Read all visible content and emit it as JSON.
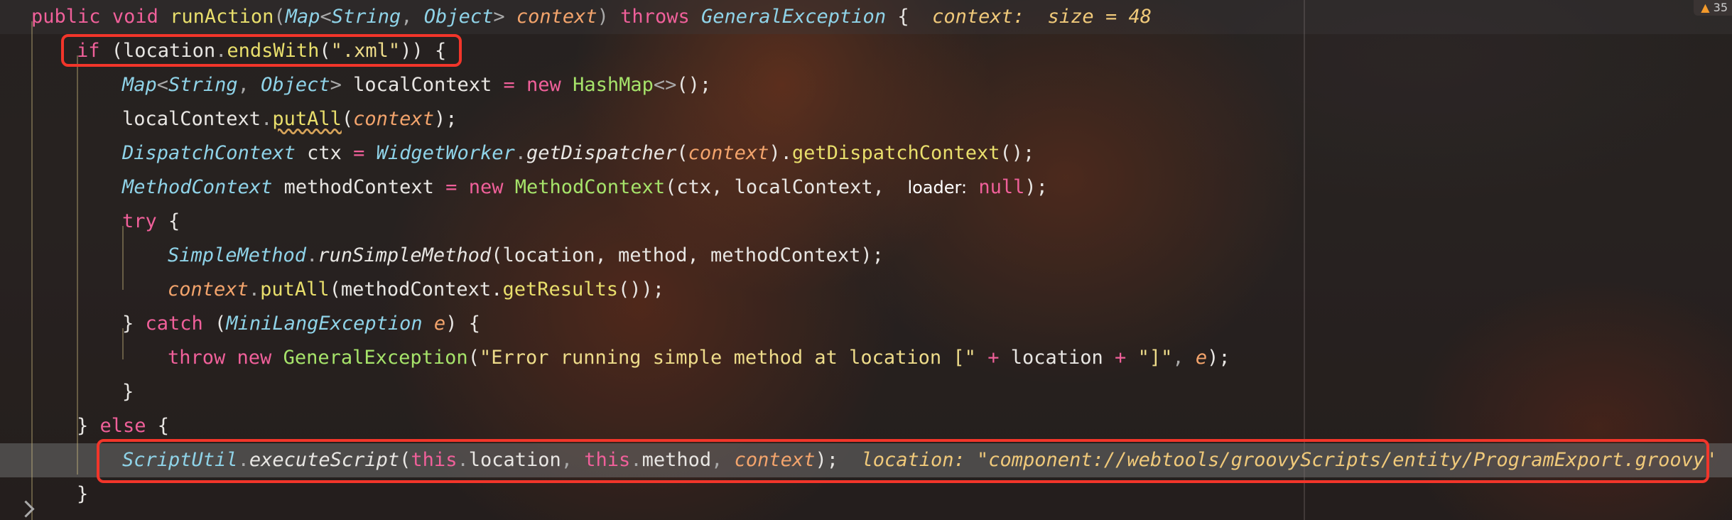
{
  "editor": {
    "warning_count": "35",
    "lines": [
      {
        "id": "l1",
        "tokens": [
          [
            "kw",
            "public"
          ],
          [
            "t",
            " "
          ],
          [
            "kw",
            "void"
          ],
          [
            "t",
            " "
          ],
          [
            "mt",
            "runAction"
          ],
          [
            "pn",
            "("
          ],
          [
            "ty",
            "Map"
          ],
          [
            "pn",
            "<"
          ],
          [
            "ty",
            "String"
          ],
          [
            "pn",
            ", "
          ],
          [
            "ty",
            "Object"
          ],
          [
            "pn",
            "> "
          ],
          [
            "param",
            "context"
          ],
          [
            "pn",
            ") "
          ],
          [
            "kw",
            "throws"
          ],
          [
            "t",
            " "
          ],
          [
            "ty",
            "GeneralException"
          ],
          [
            "t",
            " {  "
          ],
          [
            "hint",
            "context:  size = 48"
          ]
        ]
      },
      {
        "id": "l2",
        "tokens": [
          [
            "kw",
            "if"
          ],
          [
            "t",
            " ("
          ],
          [
            "t",
            "location"
          ],
          [
            "pn",
            "."
          ],
          [
            "mt",
            "endsWith"
          ],
          [
            "t",
            "("
          ],
          [
            "str",
            "\".xml\""
          ],
          [
            "t",
            ")) {"
          ]
        ]
      },
      {
        "id": "l3",
        "tokens": [
          [
            "ty",
            "Map"
          ],
          [
            "pn",
            "<"
          ],
          [
            "ty",
            "String"
          ],
          [
            "pn",
            ", "
          ],
          [
            "ty",
            "Object"
          ],
          [
            "pn",
            "> "
          ],
          [
            "t",
            "localContext "
          ],
          [
            "op",
            "="
          ],
          [
            "t",
            " "
          ],
          [
            "kw",
            "new"
          ],
          [
            "t",
            " "
          ],
          [
            "cls",
            "HashMap"
          ],
          [
            "pn",
            "<>"
          ],
          [
            "t",
            "();"
          ]
        ]
      },
      {
        "id": "l4",
        "tokens": [
          [
            "t",
            "localContext"
          ],
          [
            "pn",
            "."
          ],
          [
            "mtsq",
            "putAll"
          ],
          [
            "t",
            "("
          ],
          [
            "param",
            "context"
          ],
          [
            "t",
            ");"
          ]
        ]
      },
      {
        "id": "l5",
        "tokens": [
          [
            "ty",
            "DispatchContext"
          ],
          [
            "t",
            " ctx "
          ],
          [
            "op",
            "="
          ],
          [
            "t",
            " "
          ],
          [
            "ty",
            "WidgetWorker"
          ],
          [
            "pn",
            "."
          ],
          [
            "sm",
            "getDispatcher"
          ],
          [
            "t",
            "("
          ],
          [
            "param",
            "context"
          ],
          [
            "t",
            ")."
          ],
          [
            "mt",
            "getDispatchContext"
          ],
          [
            "t",
            "();"
          ]
        ]
      },
      {
        "id": "l6",
        "tokens": [
          [
            "ty",
            "MethodContext"
          ],
          [
            "t",
            " methodContext "
          ],
          [
            "op",
            "="
          ],
          [
            "t",
            " "
          ],
          [
            "kw",
            "new"
          ],
          [
            "t",
            " "
          ],
          [
            "cls",
            "MethodContext"
          ],
          [
            "t",
            "(ctx, localContext,  "
          ],
          [
            "hintlabel",
            "loader:"
          ],
          [
            "t",
            " "
          ],
          [
            "null",
            "null"
          ],
          [
            "t",
            ");"
          ]
        ]
      },
      {
        "id": "l7",
        "tokens": [
          [
            "kw",
            "try"
          ],
          [
            "t",
            " {"
          ]
        ]
      },
      {
        "id": "l8",
        "tokens": [
          [
            "ty",
            "SimpleMethod"
          ],
          [
            "pn",
            "."
          ],
          [
            "sm",
            "runSimpleMethod"
          ],
          [
            "t",
            "(location, method, methodContext);"
          ]
        ]
      },
      {
        "id": "l9",
        "tokens": [
          [
            "param",
            "context"
          ],
          [
            "pn",
            "."
          ],
          [
            "mt",
            "putAll"
          ],
          [
            "t",
            "(methodContext."
          ],
          [
            "mt",
            "getResults"
          ],
          [
            "t",
            "());"
          ]
        ]
      },
      {
        "id": "l10",
        "tokens": [
          [
            "t",
            "} "
          ],
          [
            "kw",
            "catch"
          ],
          [
            "t",
            " ("
          ],
          [
            "ty",
            "MiniLangException"
          ],
          [
            "t",
            " "
          ],
          [
            "param",
            "e"
          ],
          [
            "t",
            ") {"
          ]
        ]
      },
      {
        "id": "l11",
        "tokens": [
          [
            "kw",
            "throw"
          ],
          [
            "t",
            " "
          ],
          [
            "kw",
            "new"
          ],
          [
            "t",
            " "
          ],
          [
            "cls",
            "GeneralException"
          ],
          [
            "t",
            "("
          ],
          [
            "str",
            "\"Error running simple method at location [\""
          ],
          [
            "t",
            " "
          ],
          [
            "op",
            "+"
          ],
          [
            "t",
            " location "
          ],
          [
            "op",
            "+"
          ],
          [
            "t",
            " "
          ],
          [
            "str",
            "\"]\""
          ],
          [
            "pn",
            ", "
          ],
          [
            "param",
            "e"
          ],
          [
            "t",
            ");"
          ]
        ]
      },
      {
        "id": "l12",
        "tokens": [
          [
            "t",
            "}"
          ]
        ]
      },
      {
        "id": "l13",
        "tokens": [
          [
            "t",
            "} "
          ],
          [
            "kw",
            "else"
          ],
          [
            "t",
            " {"
          ]
        ]
      },
      {
        "id": "l14",
        "tokens": [
          [
            "ty",
            "ScriptUtil"
          ],
          [
            "pn",
            "."
          ],
          [
            "sm",
            "executeScript"
          ],
          [
            "t",
            "("
          ],
          [
            "kw",
            "this"
          ],
          [
            "pn",
            "."
          ],
          [
            "t",
            "location"
          ],
          [
            "pn",
            ", "
          ],
          [
            "kw",
            "this"
          ],
          [
            "pn",
            "."
          ],
          [
            "t",
            "method"
          ],
          [
            "pn",
            ", "
          ],
          [
            "param",
            "context"
          ],
          [
            "t",
            ");  "
          ],
          [
            "hint",
            "location: \"component://webtools/groovyScripts/entity/ProgramExport.groovy\""
          ]
        ]
      },
      {
        "id": "l15",
        "tokens": [
          [
            "t",
            "}"
          ]
        ]
      }
    ]
  }
}
